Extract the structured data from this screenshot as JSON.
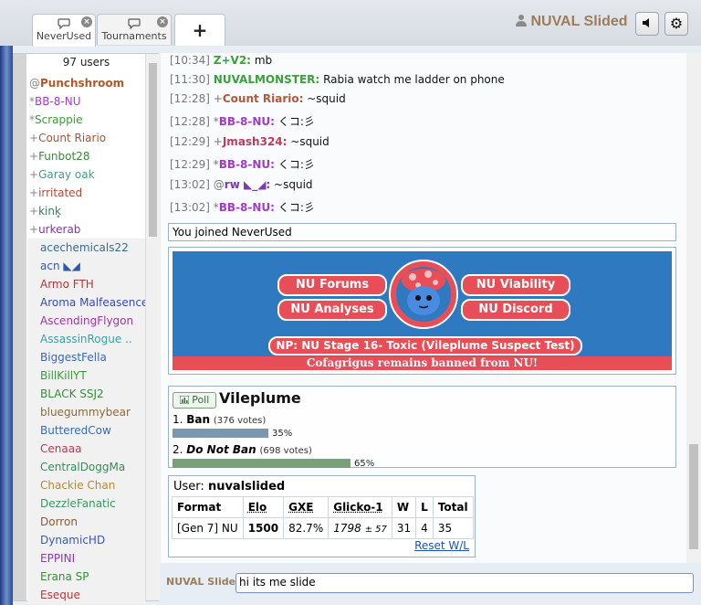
{
  "tabs": [
    {
      "label": "NeverUsed",
      "active": true
    },
    {
      "label": "Tournaments",
      "active": false
    }
  ],
  "header": {
    "new_tab_label": "+",
    "username": "NUVAL Slided",
    "mute_icon": "speaker-icon",
    "settings_icon": "gear-icon"
  },
  "userlist": {
    "count_label": "97 users",
    "users": [
      {
        "rank": "@",
        "name": "Punchshroom",
        "color": "#b05a2a",
        "bold": true
      },
      {
        "rank": "*",
        "name": "BB-8-NU",
        "color": "#a23cc8"
      },
      {
        "rank": "*",
        "name": "Scrappie",
        "color": "#3a9a3a"
      },
      {
        "rank": "+",
        "name": "Count Riario",
        "color": "#9a5a3a"
      },
      {
        "rank": "+",
        "name": "Funbot28",
        "color": "#3a8a3a"
      },
      {
        "rank": "+",
        "name": "Garay oak",
        "color": "#4a9a8a"
      },
      {
        "rank": "+",
        "name": "irritated",
        "color": "#b04a3a"
      },
      {
        "rank": "+",
        "name": "kink̥",
        "color": "#3a7a5a"
      },
      {
        "rank": "+",
        "name": "urkerab",
        "color": "#7a3a9a"
      },
      {
        "rank": "",
        "name": "acechemicals22",
        "color": "#3a6a8a"
      },
      {
        "rank": "",
        "name": "acn ◣◢",
        "color": "#2a5ab0"
      },
      {
        "rank": "",
        "name": "Armo FTH",
        "color": "#b03a3a"
      },
      {
        "rank": "",
        "name": "Aroma Malfeasence",
        "color": "#3a4ab0"
      },
      {
        "rank": "",
        "name": "AscendingFlygon",
        "color": "#9a3aa0"
      },
      {
        "rank": "",
        "name": "AssassinRogue ..",
        "color": "#3aa0a0"
      },
      {
        "rank": "",
        "name": "BiggestFella",
        "color": "#3a6ab0"
      },
      {
        "rank": "",
        "name": "BillKillYT",
        "color": "#3a9a3a"
      },
      {
        "rank": "",
        "name": "BLACK SSJ2",
        "color": "#3a8a3a"
      },
      {
        "rank": "",
        "name": "bluegummybear",
        "color": "#8a6a3a"
      },
      {
        "rank": "",
        "name": "ButteredCow",
        "color": "#3a6ab0"
      },
      {
        "rank": "",
        "name": "Cenaaa",
        "color": "#b03a5a"
      },
      {
        "rank": "",
        "name": "CentralDoggMa",
        "color": "#3a8a5a"
      },
      {
        "rank": "",
        "name": "Chackie Chan",
        "color": "#b08a3a"
      },
      {
        "rank": "",
        "name": "DezzleFanatic",
        "color": "#3a9a5a"
      },
      {
        "rank": "",
        "name": "Dorron",
        "color": "#8a5a3a"
      },
      {
        "rank": "",
        "name": "DynamicHD",
        "color": "#3a5ab0"
      },
      {
        "rank": "",
        "name": "EPPINI",
        "color": "#8a3ab0"
      },
      {
        "rank": "",
        "name": "Erana SP",
        "color": "#3a8a3a"
      },
      {
        "rank": "",
        "name": "Eseque",
        "color": "#b03a3a"
      }
    ]
  },
  "messages": [
    {
      "ts": "[10:34]",
      "rank": "",
      "name": "Z+V2:",
      "color": "#3aa03a",
      "text": "mb"
    },
    {
      "ts": "[11:30]",
      "rank": "",
      "name": "NUVALMONSTER:",
      "color": "#3aa03a",
      "text": "Rabia watch me ladder on phone"
    },
    {
      "ts": "[12:28]",
      "rank": "+",
      "name": "Count Riario:",
      "color": "#b05a3a",
      "text": "~squid"
    },
    {
      "ts": "[12:28]",
      "rank": "*",
      "name": "BB-8-NU:",
      "color": "#a23cc8",
      "text": "くコ:彡"
    },
    {
      "ts": "[12:29]",
      "rank": "+",
      "name": "Jmash324:",
      "color": "#c03a5a",
      "text": "~squid"
    },
    {
      "ts": "[12:29]",
      "rank": "*",
      "name": "BB-8-NU:",
      "color": "#a23cc8",
      "text": "くコ:彡"
    },
    {
      "ts": "[13:02]",
      "rank": "@",
      "name": "rw ◣_◢:",
      "color": "#7a3ab0",
      "text": "~squid"
    },
    {
      "ts": "[13:02]",
      "rank": "*",
      "name": "BB-8-NU:",
      "color": "#a23cc8",
      "text": "くコ:彡"
    }
  ],
  "join_notice": "You joined NeverUsed",
  "banner": {
    "forums": "NU Forums",
    "viability": "NU Viability",
    "analyses": "NU Analyses",
    "discord": "NU Discord",
    "np": "NP: NU Stage 16- Toxic (Vileplume Suspect Test)",
    "footer": "Cofagrigus remains banned from NU!",
    "accent": "#e84e57",
    "bg": "#2f79c1"
  },
  "poll": {
    "badge": "Poll",
    "title": "Vileplume",
    "options": [
      {
        "num": "1.",
        "label": "Ban",
        "votes": "(376 votes)",
        "pct_label": "35%",
        "pct": 0.35,
        "color": "#7a96b0"
      },
      {
        "num": "2.",
        "label": "Do Not Ban",
        "votes": "(698 votes)",
        "pct_label": "65%",
        "pct": 0.65,
        "color": "#7aa07a"
      }
    ]
  },
  "stats": {
    "user_label": "User:",
    "user_name": "nuvalslided",
    "headers": [
      "Format",
      "Elo",
      "GXE",
      "Glicko-1",
      "W",
      "L",
      "Total"
    ],
    "row": {
      "format": "[Gen 7] NU",
      "elo": "1500",
      "gxe": "82.7%",
      "glicko": "1798",
      "glicko_dev": "± 57",
      "w": "31",
      "l": "4",
      "total": "35"
    },
    "reset": "Reset W/L"
  },
  "input": {
    "name": "NUVAL Slide",
    "value": "hi its me slide"
  }
}
